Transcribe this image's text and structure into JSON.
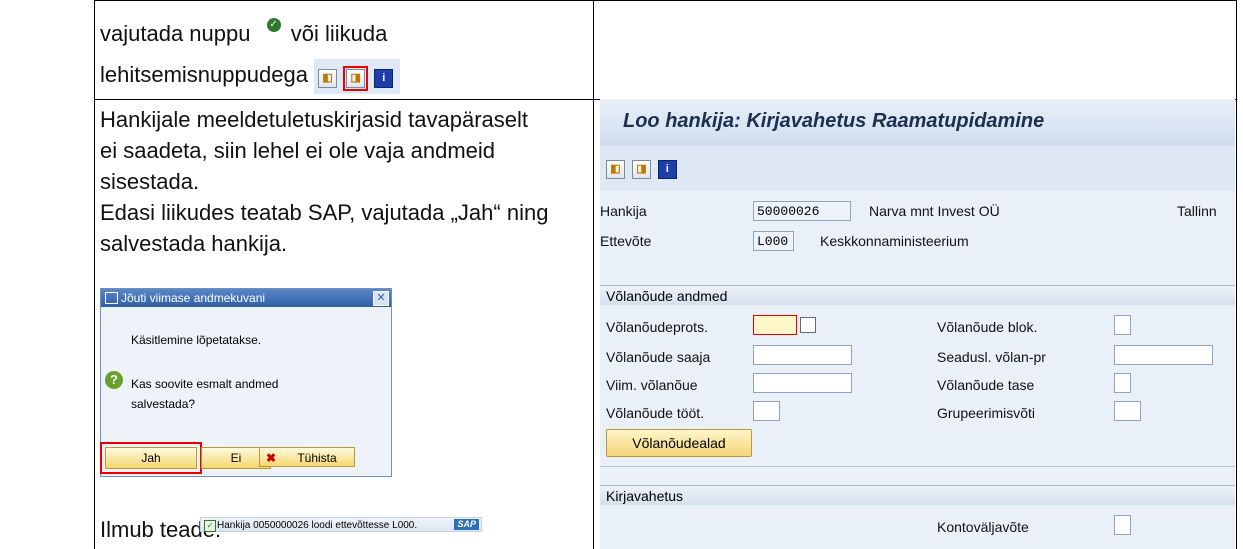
{
  "top_left": {
    "line1": "vajutada nuppu",
    "line1_end": "või liikuda",
    "line2": "lehitsemisnuppudega"
  },
  "instructions": {
    "p1_l1": "Hankijale meeldetuletuskirjasid tavapäraselt",
    "p1_l2": "ei saadeta, siin lehel ei ole vaja andmeid",
    "p1_l3": "sisestada.",
    "p2_l1": "Edasi liikudes teatab SAP, vajutada „Jah“ ning",
    "p2_l2": "salvestada hankija."
  },
  "dialog": {
    "title": "Jõuti viimase andmekuvani",
    "close": "✕",
    "msg1": "Käsitlemine lõpetatakse.",
    "q1": "Kas soovite esmalt andmed",
    "q2": "salvestada?",
    "yes": "Jah",
    "no": "Ei",
    "cancel": "Tühista"
  },
  "notice": {
    "label": "Ilmub teade:",
    "status_text": "Hankija 0050000026 loodi ettevõttesse L000.",
    "logo": "SAP"
  },
  "sap": {
    "title": "Loo hankija: Kirjavahetus Raamatupidamine",
    "vendor_label": "Hankija",
    "vendor_value": "50000026",
    "vendor_name": "Narva mnt Invest OÜ",
    "vendor_city": "Tallinn",
    "company_label": "Ettevõte",
    "company_value": "L000",
    "company_name": "Keskkonnaministeerium",
    "dunning_section": "Võlanõude andmed",
    "dunning_procedure": "Võlanõudeprots.",
    "dunning_recipient": "Võlanõude saaja",
    "last_dunned": "Viim. võlanõue",
    "dunning_clerk": "Võlanõude tööt.",
    "dunning_block": "Võlanõude blok.",
    "legal_dunning": "Seadusl. võlan-pr",
    "dunning_level": "Võlanõude tase",
    "grouping_key": "Grupeerimisvõti",
    "dunning_areas_button": "Võlanõudealad",
    "correspondence_section": "Kirjavahetus",
    "account_statement": "Kontoväljavõte"
  }
}
